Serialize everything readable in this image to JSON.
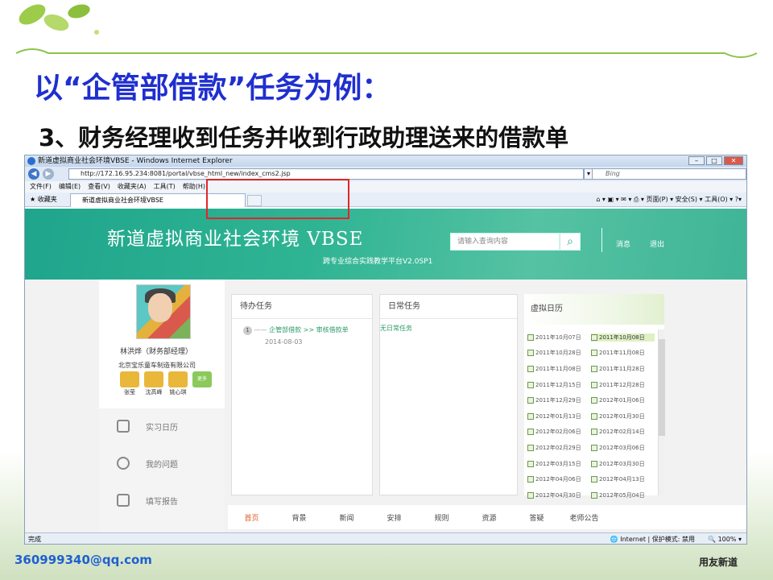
{
  "slide": {
    "heading": "以“企管部借款”任务为例：",
    "subheading": "3、财务经理收到任务并收到行政助理送来的借款单",
    "email": "360999340@qq.com",
    "brand": "用友新道"
  },
  "browser": {
    "window_title": "新道虚拟商业社会环境VBSE - Windows Internet Explorer",
    "address": "http://172.16.95.234:8081/portal/vbse_html_new/index_cms2.jsp",
    "search_placeholder": "Bing",
    "menu": [
      "文件(F)",
      "编辑(E)",
      "查看(V)",
      "收藏夹(A)",
      "工具(T)",
      "帮助(H)"
    ],
    "favorites_label": "收藏夹",
    "tab_label": "新道虚拟商业社会环境VBSE",
    "command_bar": "页面(P) ▾  安全(S) ▾  工具(O) ▾",
    "status_left": "完成",
    "status_zone": "Internet | 保护模式: 禁用",
    "zoom": "100%"
  },
  "app": {
    "title": "新道虚拟商业社会环境 VBSE",
    "subtitle": "跨专业综合实践教学平台V2.0SP1",
    "search_placeholder": "请输入查询内容",
    "messages_label": "消息",
    "logout_label": "退出",
    "user_name": "林洪烨（财务部经理）",
    "company": "北京宝乐童车制造有限公司",
    "contacts": [
      "张莹",
      "沈高峰",
      "姚心琪",
      "更多"
    ],
    "side_menu": [
      "实习日历",
      "我的问题",
      "填写报告"
    ],
    "todo": {
      "title": "待办任务",
      "item_index": "1",
      "item_link": "企管部借款 >> 审核借款单",
      "item_date": "2014-08-03"
    },
    "daily": {
      "title": "日常任务",
      "empty_text": "无日常任务"
    },
    "calendar": {
      "title": "虚拟日历",
      "dates": [
        [
          "2011年10月07日",
          "2011年10月08日"
        ],
        [
          "2011年10月28日",
          "2011年11月08日"
        ],
        [
          "2011年11月08日",
          "2011年11月28日"
        ],
        [
          "2011年12月15日",
          "2011年12月28日"
        ],
        [
          "2011年12月29日",
          "2012年01月06日"
        ],
        [
          "2012年01月13日",
          "2012年01月30日"
        ],
        [
          "2012年02月06日",
          "2012年02月14日"
        ],
        [
          "2012年02月29日",
          "2012年03月06日"
        ],
        [
          "2012年03月15日",
          "2012年03月30日"
        ],
        [
          "2012年04月06日",
          "2012年04月13日"
        ],
        [
          "2012年04月30日",
          "2012年05月04日"
        ]
      ]
    },
    "bottom_nav": [
      "首页",
      "背景",
      "新闻",
      "安排",
      "规则",
      "资源",
      "答疑",
      "老师公告"
    ]
  }
}
